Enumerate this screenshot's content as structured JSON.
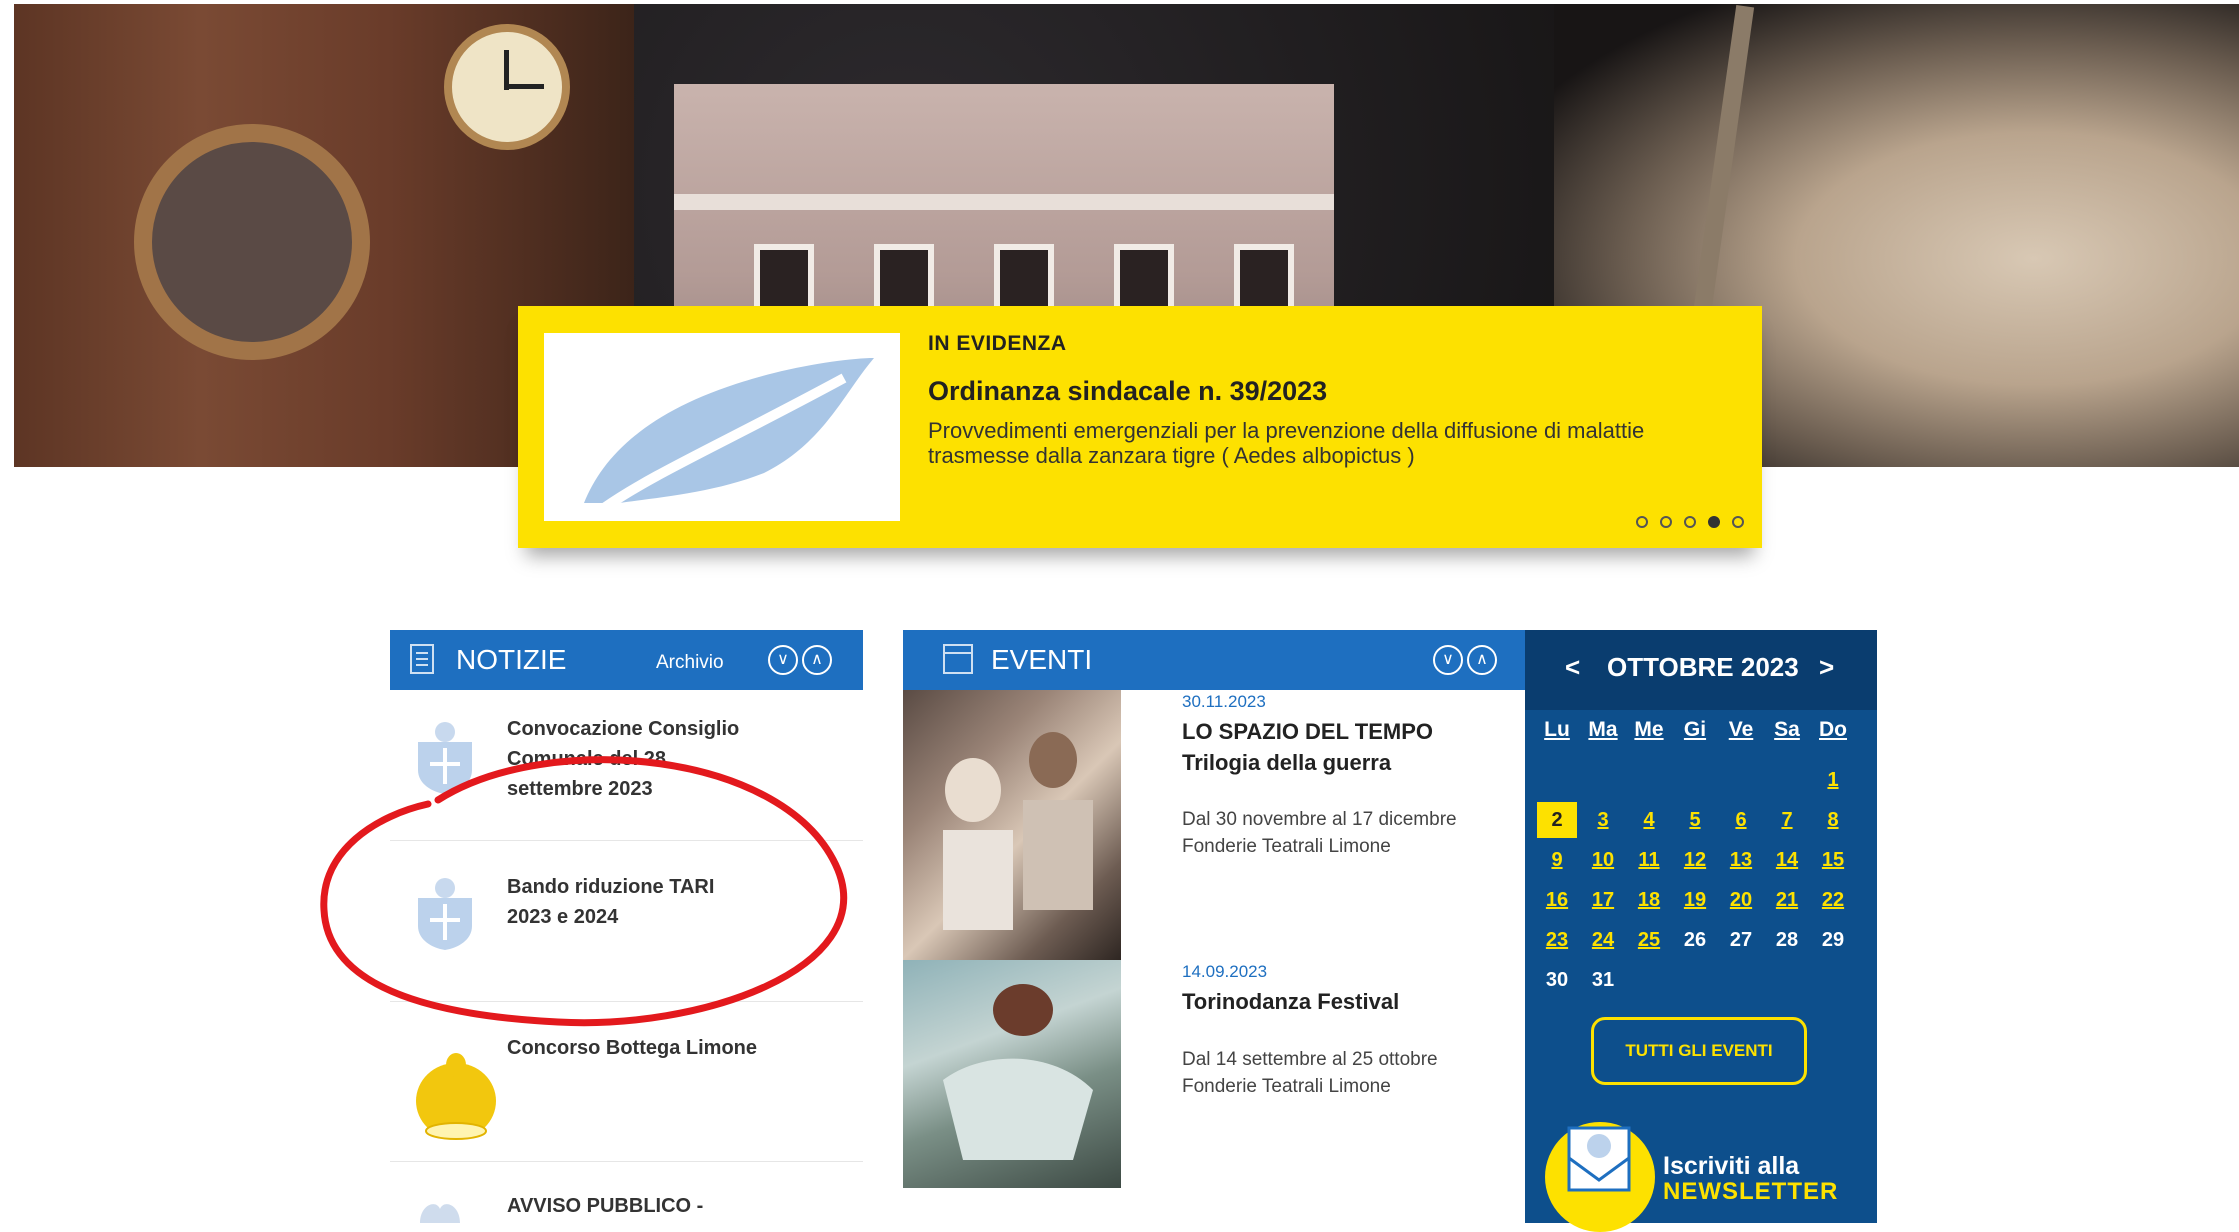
{
  "evidenza": {
    "kicker": "IN EVIDENZA",
    "title": "Ordinanza sindacale n. 39/2023",
    "description": "Provvedimenti emergenziali per la prevenzione della diffusione di malattie trasmesse dalla zanzara tigre ( Aedes albopictus )",
    "slides": 5,
    "active_slide": 4
  },
  "notizie": {
    "title": "NOTIZIE",
    "archive_link": "Archivio",
    "items": [
      {
        "title": "Convocazione Consiglio Comunale del 28 settembre 2023",
        "thumb": "crest-icon"
      },
      {
        "title": "Bando riduzione TARI 2023 e 2024",
        "thumb": "crest-icon"
      },
      {
        "title": "Concorso Bottega Limone",
        "thumb": "lemon-icon"
      },
      {
        "title": "AVVISO PUBBLICO -",
        "thumb": "ribbon-icon"
      }
    ]
  },
  "eventi": {
    "title": "EVENTI",
    "items": [
      {
        "date": "30.11.2023",
        "title_line1": "LO SPAZIO DEL TEMPO",
        "title_line2": "Trilogia della guerra",
        "period": "Dal  30 novembre al 17 dicembre",
        "venue": "Fonderie Teatrali Limone"
      },
      {
        "date": "14.09.2023",
        "title_line1": "Torinodanza Festival",
        "period": "Dal  14 settembre al 25 ottobre",
        "venue": "Fonderie Teatrali Limone"
      }
    ]
  },
  "calendar": {
    "prev": "<",
    "next": ">",
    "month": "OTTOBRE 2023",
    "weekdays": [
      "Lu",
      "Ma",
      "Me",
      "Gi",
      "Ve",
      "Sa",
      "Do"
    ],
    "rows": [
      [
        "",
        "",
        "",
        "",
        "",
        "",
        "1"
      ],
      [
        "2",
        "3",
        "4",
        "5",
        "6",
        "7",
        "8"
      ],
      [
        "9",
        "10",
        "11",
        "12",
        "13",
        "14",
        "15"
      ],
      [
        "16",
        "17",
        "18",
        "19",
        "20",
        "21",
        "22"
      ],
      [
        "23",
        "24",
        "25",
        "26",
        "27",
        "28",
        "29"
      ],
      [
        "30",
        "31",
        "",
        "",
        "",
        "",
        ""
      ]
    ],
    "today": "2",
    "linked_days": [
      "1",
      "3",
      "4",
      "5",
      "6",
      "7",
      "8",
      "9",
      "10",
      "11",
      "12",
      "13",
      "14",
      "15",
      "16",
      "17",
      "18",
      "19",
      "20",
      "21",
      "22",
      "23",
      "24",
      "25"
    ],
    "all_events_button": "TUTTI GLI EVENTI",
    "newsletter_line1": "Iscriviti alla",
    "newsletter_line2": "NEWSLETTER"
  },
  "colors": {
    "accent_yellow": "#fde100",
    "primary_blue": "#1e6fc0",
    "dark_blue": "#0d4f8c",
    "annotation_red": "#e3191d"
  }
}
